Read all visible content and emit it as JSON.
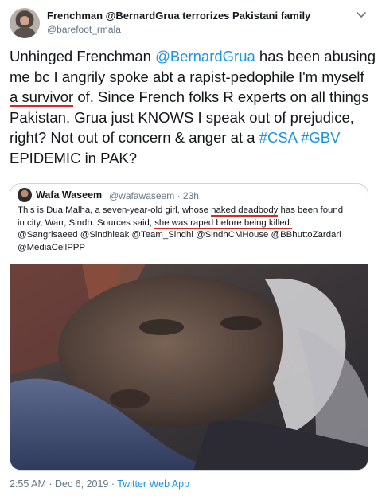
{
  "author": {
    "name": "Frenchman @BernardGrua terrorizes Pakistani family",
    "handle": "@barefoot_rmala"
  },
  "tweet": {
    "line1_pre": "Unhinged Frenchman ",
    "line1_mention": "@BernardGrua",
    "line1_post": " has been abusing",
    "line2": "me bc I angrily spoke abt a rapist-pedophile I'm myself",
    "line3_underlined": "a survivor",
    "line3_post": " of. Since French folks R experts on all things",
    "line4": "Pakistan, Grua just KNOWS I speak out of prejudice,",
    "line5_pre": "right? Not out of concern & anger at a ",
    "line5_tag1": "#CSA",
    "line5_space": " ",
    "line5_tag2": "#GBV",
    "line6": " EPIDEMIC in PAK?"
  },
  "quoted_tweet": {
    "name": "Wafa Waseem",
    "handle": "@wafawaseem",
    "separator": "·",
    "time": "23h",
    "line1_pre": "This is Dua Malha, a seven-year-old girl, whose ",
    "line1_underlined": "naked deadbody",
    "line1_post": " has been found",
    "line2_pre": "in city, Warr, Sindh. Sources said, ",
    "line2_underlined": "she was raped before being killed.",
    "line3": "@Sangrisaeed @Sindhleak @Team_Sindhi @SindhCMHouse @BBhuttoZardari",
    "line4": "@MediaCellPPP"
  },
  "footer": {
    "datetime": "2:55 AM · Dec 6, 2019 · ",
    "source": "Twitter Web App"
  },
  "icons": {
    "menu": "chevron-down-icon"
  }
}
